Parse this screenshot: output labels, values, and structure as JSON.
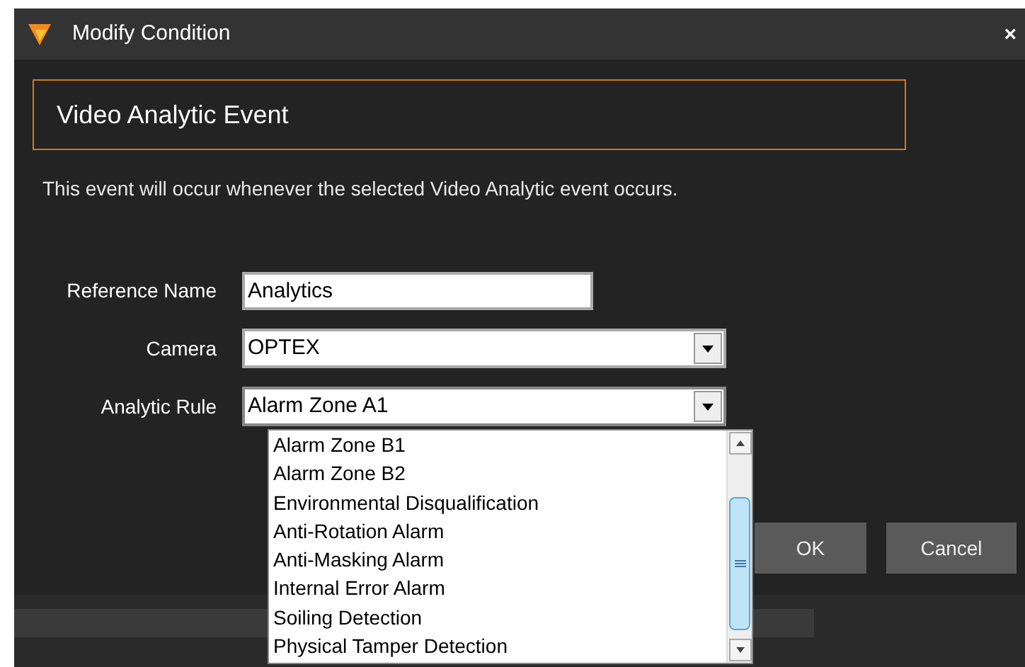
{
  "window": {
    "title": "Modify Condition",
    "close": "×"
  },
  "header": "Video Analytic Event",
  "description": "This event will occur whenever the selected Video Analytic event occurs.",
  "fields": [
    {
      "kind": "text",
      "label": "Reference Name",
      "value": "Analytics"
    },
    {
      "kind": "select",
      "label": "Camera",
      "value": "OPTEX"
    },
    {
      "kind": "select",
      "label": "Analytic Rule",
      "value": "Alarm Zone A1",
      "expanded": true
    }
  ],
  "dropdown_options": [
    {
      "label": "Alarm Zone B1",
      "selected": false
    },
    {
      "label": "Alarm Zone B2",
      "selected": false
    },
    {
      "label": "Environmental Disqualification",
      "selected": false
    },
    {
      "label": "Anti-Rotation Alarm",
      "selected": false
    },
    {
      "label": "Anti-Masking Alarm",
      "selected": false
    },
    {
      "label": "Internal Error Alarm",
      "selected": false
    },
    {
      "label": "Soiling Detection",
      "selected": false
    },
    {
      "label": "Physical Tamper Detection",
      "selected": false
    }
  ],
  "buttons": [
    "OK",
    "Cancel"
  ]
}
